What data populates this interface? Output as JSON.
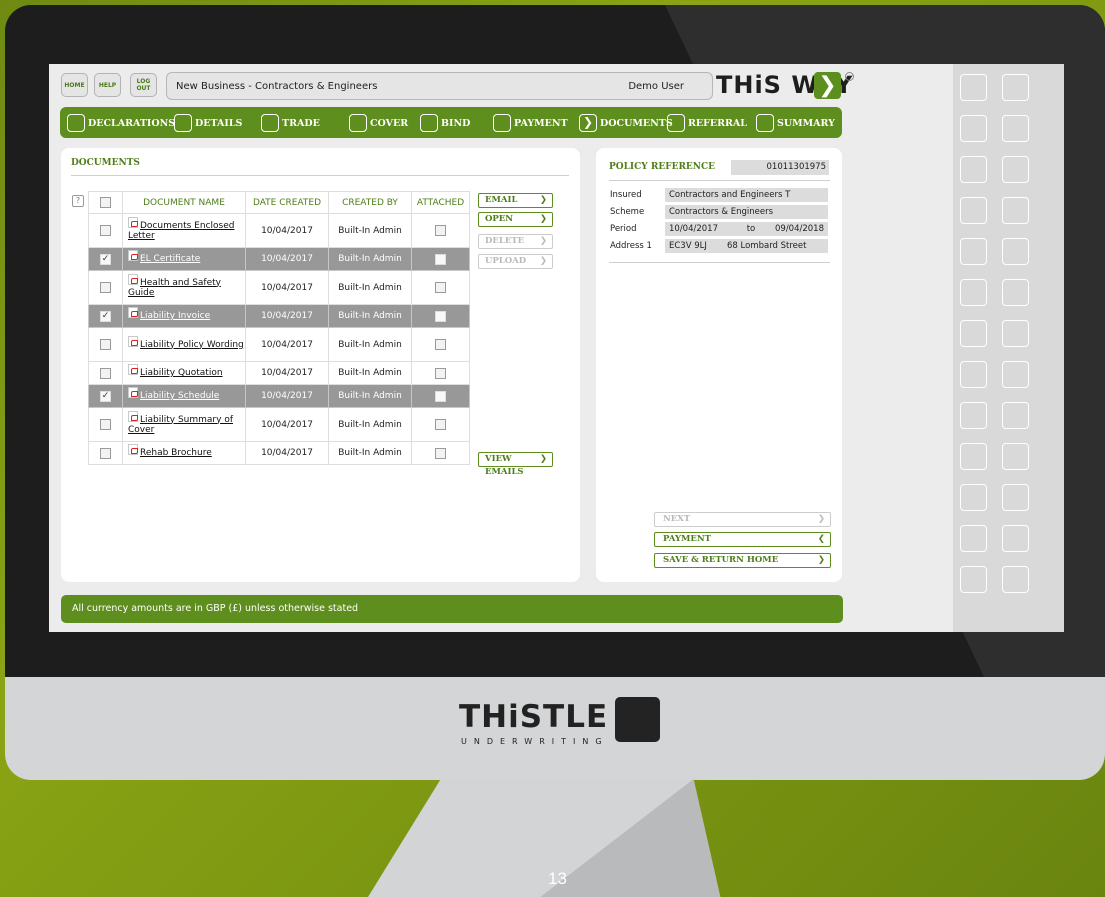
{
  "topbar": {
    "home": "HOME",
    "help": "HELP",
    "logout": "LOG OUT",
    "title": "New Business - Contractors & Engineers",
    "user": "Demo User",
    "brand": "THiS WAY",
    "brand_arrow": "❯"
  },
  "nav": [
    {
      "label": "DECLARATIONS",
      "icon": ""
    },
    {
      "label": "DETAILS",
      "icon": ""
    },
    {
      "label": "TRADE",
      "icon": ""
    },
    {
      "label": "COVER",
      "icon": ""
    },
    {
      "label": "BIND",
      "icon": ""
    },
    {
      "label": "PAYMENT",
      "icon": ""
    },
    {
      "label": "DOCUMENTS",
      "icon": "❯"
    },
    {
      "label": "REFERRAL",
      "icon": ""
    },
    {
      "label": "SUMMARY",
      "icon": ""
    }
  ],
  "documents": {
    "title": "DOCUMENTS",
    "help": "?",
    "columns": [
      "DOCUMENT NAME",
      "DATE CREATED",
      "CREATED BY",
      "ATTACHED"
    ],
    "rows": [
      {
        "name": "Documents Enclosed Letter",
        "date": "10/04/2017",
        "by": "Built-In Admin",
        "selected": false,
        "mark": ""
      },
      {
        "name": "EL Certificate",
        "date": "10/04/2017",
        "by": "Built-In Admin",
        "selected": true,
        "mark": "✓"
      },
      {
        "name": "Health and Safety Guide",
        "date": "10/04/2017",
        "by": "Built-In Admin",
        "selected": false,
        "mark": ""
      },
      {
        "name": "Liability Invoice",
        "date": "10/04/2017",
        "by": "Built-In Admin",
        "selected": true,
        "mark": "✓"
      },
      {
        "name": "Liability Policy Wording",
        "date": "10/04/2017",
        "by": "Built-In Admin",
        "selected": false,
        "mark": ""
      },
      {
        "name": "Liability Quotation",
        "date": "10/04/2017",
        "by": "Built-In Admin",
        "selected": false,
        "mark": ""
      },
      {
        "name": "Liability Schedule",
        "date": "10/04/2017",
        "by": "Built-In Admin",
        "selected": true,
        "mark": "✓"
      },
      {
        "name": "Liability Summary of Cover",
        "date": "10/04/2017",
        "by": "Built-In Admin",
        "selected": false,
        "mark": ""
      },
      {
        "name": "Rehab Brochure",
        "date": "10/04/2017",
        "by": "Built-In Admin",
        "selected": false,
        "mark": ""
      }
    ],
    "actions": {
      "email": "EMAIL",
      "open": "OPEN",
      "delete": "DELETE",
      "upload": "UPLOAD",
      "view_emails": "VIEW EMAILS",
      "chevron": "❯"
    }
  },
  "policy": {
    "title": "POLICY REFERENCE",
    "reference": "01011301975",
    "insured_label": "Insured",
    "insured": "Contractors and Engineers T",
    "scheme_label": "Scheme",
    "scheme": "Contractors & Engineers",
    "period_label": "Period",
    "period_from": "10/04/2017",
    "period_to_label": "to",
    "period_to": "09/04/2018",
    "address_label": "Address 1",
    "postcode": "EC3V 9LJ",
    "address": "68 Lombard Street"
  },
  "footer_buttons": {
    "next": "NEXT",
    "next_chev": "❯",
    "payment": "PAYMENT",
    "payment_chev": "❮",
    "save": "SAVE & RETURN HOME",
    "save_chev": "❯"
  },
  "currency_note": "All currency amounts are in GBP (£) unless otherwise stated",
  "brand": {
    "logo_word": "THiSTLE",
    "logo_sub": "UNDERWRITING",
    "accent": "#5e8e1d"
  },
  "page_number": "13"
}
